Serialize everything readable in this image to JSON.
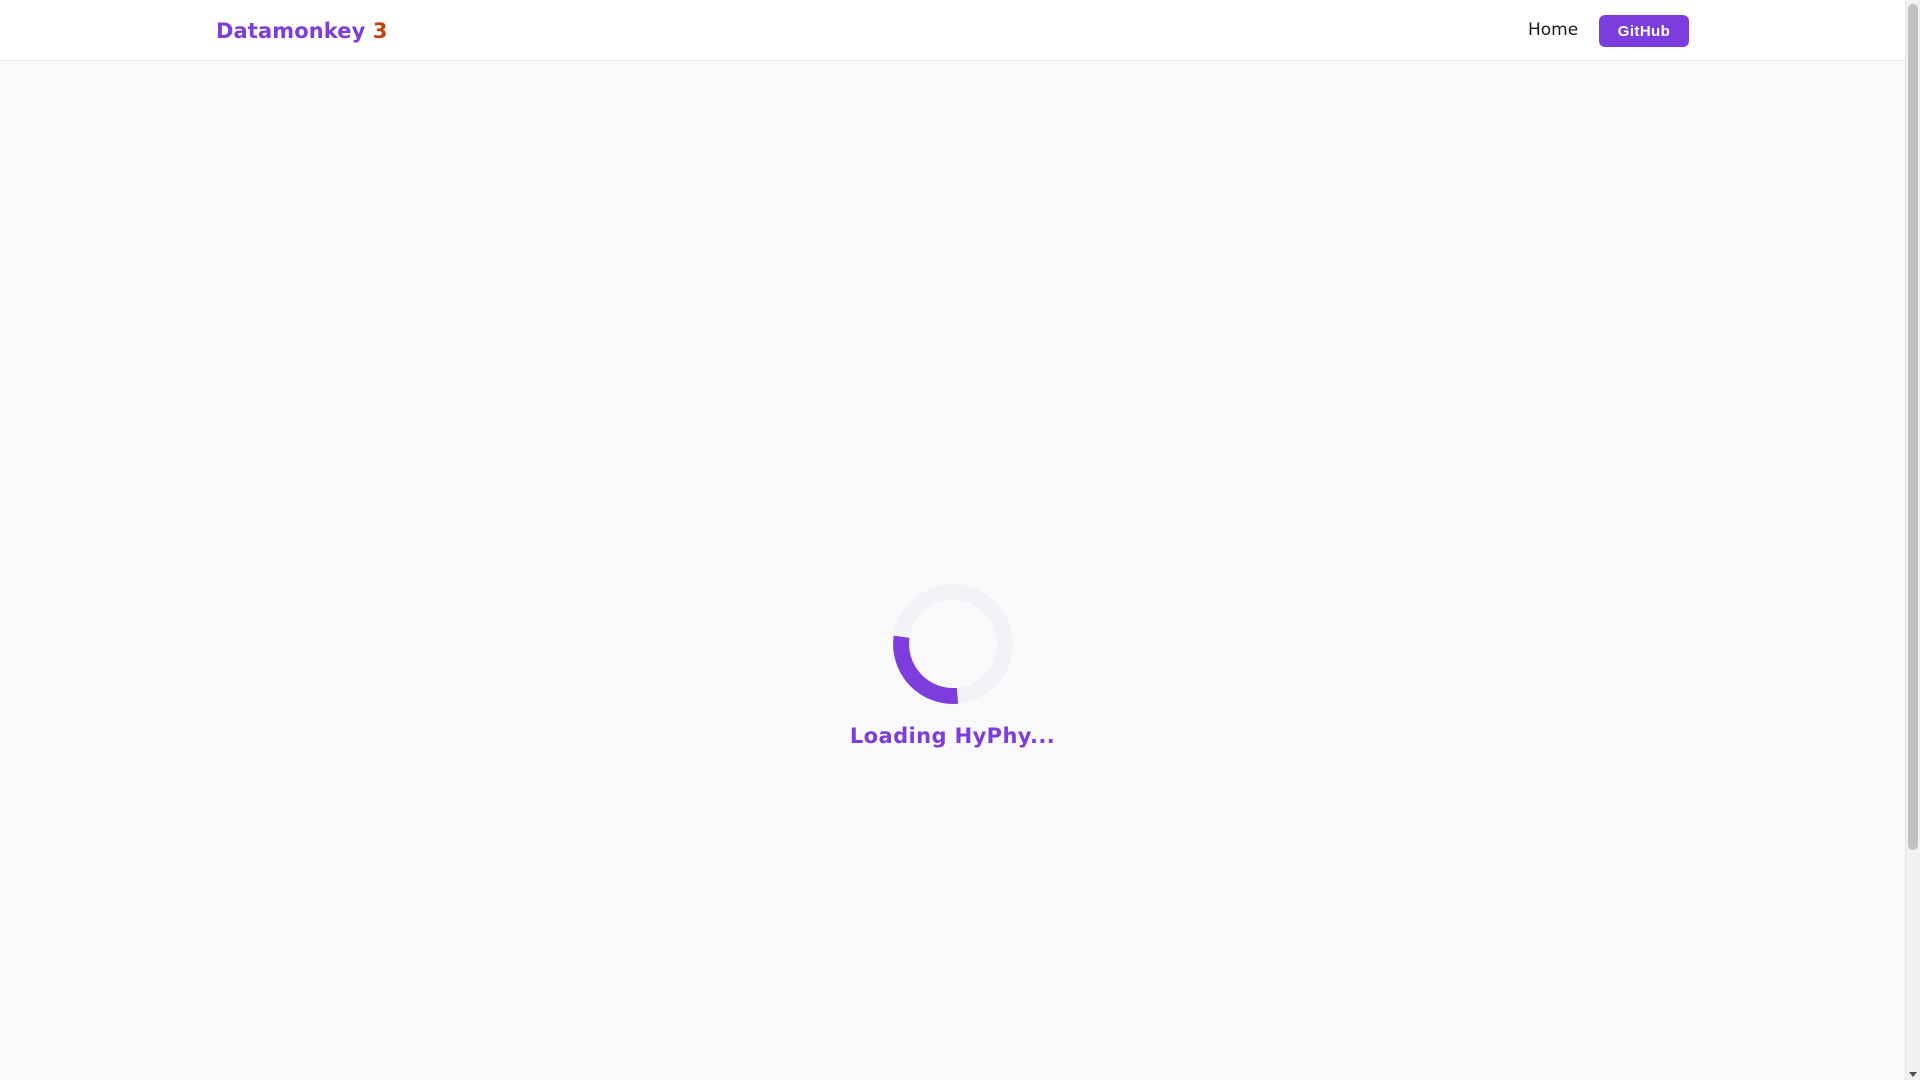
{
  "navbar": {
    "brand_name": "Datamonkey",
    "brand_version": "3",
    "home_label": "Home",
    "github_label": "GitHub"
  },
  "loader": {
    "text": "Loading HyPhy...",
    "spinner_icon": "spinner-icon"
  },
  "colors": {
    "accent": "#7c3ddc",
    "version_accent": "#c2410c",
    "spinner_track": "#f1f2f6",
    "background": "#f9f9fb"
  }
}
